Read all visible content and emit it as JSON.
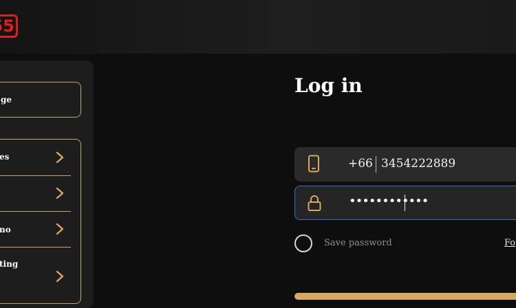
{
  "header": {
    "logo_text": "55"
  },
  "sidebar": {
    "language_label": "ge",
    "items": [
      {
        "label": "es"
      },
      {
        "label": ""
      },
      {
        "label": "no"
      },
      {
        "label": "ting"
      }
    ]
  },
  "login": {
    "title": "Log in",
    "phone": {
      "code": "+66",
      "number": "3454222889"
    },
    "password": {
      "masked": "••••••••••••"
    },
    "save_password_label": "Save password",
    "forgot_label": "Fo"
  },
  "colors": {
    "accent": "#c9a36a",
    "focus": "#2f6fe0",
    "logo": "#e21c1c"
  }
}
